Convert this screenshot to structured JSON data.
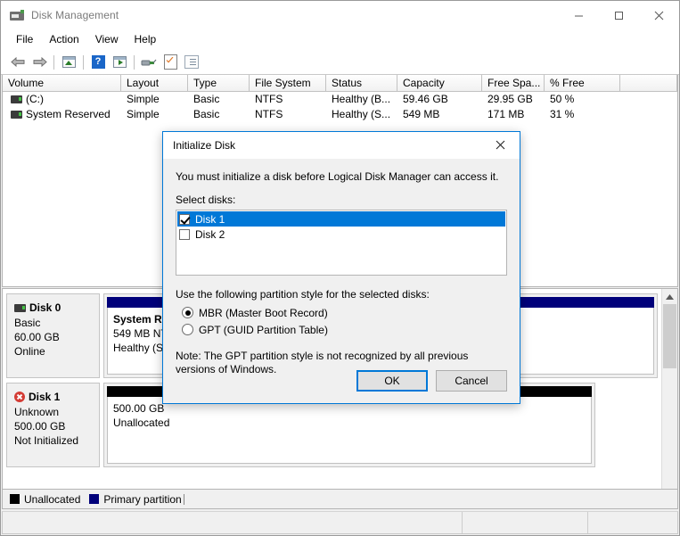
{
  "window": {
    "title": "Disk Management",
    "icon": "disk-drive-icon",
    "controls": {
      "minimize": "–",
      "maximize": "□",
      "close": "✕"
    }
  },
  "menubar": {
    "items": [
      "File",
      "Action",
      "View",
      "Help"
    ]
  },
  "toolbar": {
    "items": [
      {
        "name": "back-icon",
        "label": "Back"
      },
      {
        "name": "forward-icon",
        "label": "Forward"
      },
      {
        "name": "show-hide-console-tree-icon",
        "label": "Show/Hide Console Tree"
      },
      {
        "name": "help-icon",
        "label": "Help",
        "glyph": "?"
      },
      {
        "name": "show-hide-action-pane-icon",
        "label": "Show/Hide Action Pane"
      },
      {
        "name": "rescan-disks-icon",
        "label": "Rescan Disks"
      },
      {
        "name": "properties-icon",
        "label": "Properties"
      },
      {
        "name": "all-tasks-icon",
        "label": "All Tasks"
      }
    ]
  },
  "volume_table": {
    "columns": [
      "Volume",
      "Layout",
      "Type",
      "File System",
      "Status",
      "Capacity",
      "Free Spa...",
      "% Free",
      ""
    ],
    "rows": [
      {
        "volume": "(C:)",
        "layout": "Simple",
        "type": "Basic",
        "file_system": "NTFS",
        "status": "Healthy (B...",
        "capacity": "59.46 GB",
        "free_space": "29.95 GB",
        "percent_free": "50 %"
      },
      {
        "volume": "System Reserved",
        "layout": "Simple",
        "type": "Basic",
        "file_system": "NTFS",
        "status": "Healthy (S...",
        "capacity": "549 MB",
        "free_space": "171 MB",
        "percent_free": "31 %"
      }
    ]
  },
  "disks": [
    {
      "name": "Disk 0",
      "icon": "disk-drive-icon",
      "type": "Basic",
      "size": "60.00 GB",
      "status": "Online",
      "partitions": [
        {
          "style": "primary",
          "title": "System Res",
          "line2": "549 MB NTF",
          "line3": "Healthy (Sys"
        },
        {
          "style": "primary",
          "title": "",
          "line2": "",
          "line3": ""
        }
      ]
    },
    {
      "name": "Disk 1",
      "icon": "disk-error-icon",
      "type": "Unknown",
      "size": "500.00 GB",
      "status": "Not Initialized",
      "partitions": [
        {
          "style": "unalloc",
          "title": "",
          "line2": "500.00 GB",
          "line3": "Unallocated"
        }
      ]
    }
  ],
  "legend": {
    "items": [
      {
        "label": "Unallocated",
        "color": "#000000"
      },
      {
        "label": "Primary partition",
        "color": "#00007a"
      }
    ]
  },
  "statusbar": {
    "text": ""
  },
  "dialog": {
    "title": "Initialize Disk",
    "close_label": "✕",
    "description": "You must initialize a disk before Logical Disk Manager can access it.",
    "select_disks_label": "Select disks:",
    "disk_list": [
      {
        "label": "Disk 1",
        "checked": true,
        "selected": true
      },
      {
        "label": "Disk 2",
        "checked": false,
        "selected": false
      }
    ],
    "partition_style_label": "Use the following partition style for the selected disks:",
    "partition_styles": [
      {
        "label": "MBR (Master Boot Record)",
        "selected": true
      },
      {
        "label": "GPT (GUID Partition Table)",
        "selected": false
      }
    ],
    "note": "Note: The GPT partition style is not recognized by all previous versions of Windows.",
    "ok_label": "OK",
    "cancel_label": "Cancel"
  },
  "colors": {
    "accent": "#0078d7",
    "primary_partition": "#00007a",
    "unallocated": "#000000",
    "error": "#d43c35"
  }
}
